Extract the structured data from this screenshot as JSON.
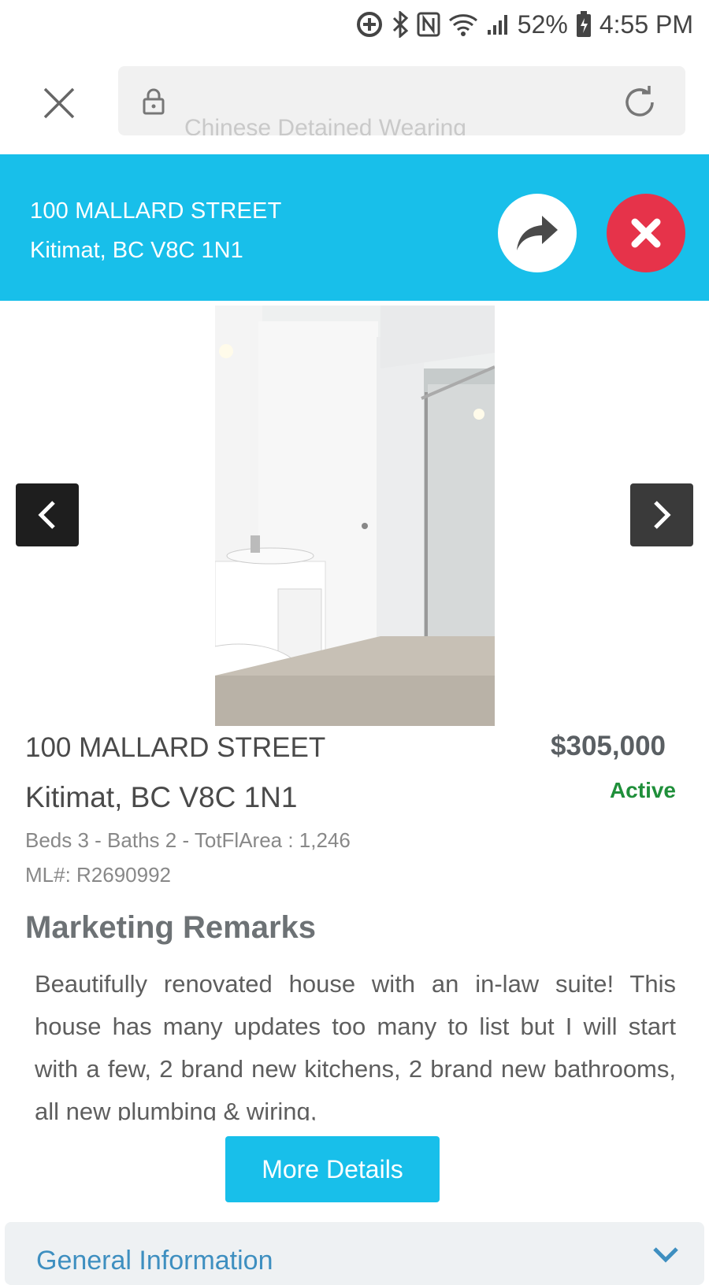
{
  "status_bar": {
    "battery": "52%",
    "time": "4:55 PM",
    "icons": [
      "data-saver-icon",
      "bluetooth-icon",
      "nfc-icon",
      "wifi-icon",
      "signal-icon",
      "battery-charging-icon"
    ]
  },
  "browser": {
    "url_text": "Chinese Detained Wearing",
    "icons": [
      "close-icon",
      "lock-icon",
      "reload-icon"
    ]
  },
  "header": {
    "street": "100 MALLARD STREET",
    "city": "Kitimat, BC V8C 1N1",
    "accent_color": "#18bfea",
    "dismiss_color": "#e6334a"
  },
  "listing": {
    "street": "100 MALLARD STREET",
    "city": "Kitimat, BC V8C 1N1",
    "price": "$305,000",
    "status": "Active",
    "status_color": "#1f8f3a",
    "specs": "Beds 3 - Baths 2 - TotFlArea : 1,246",
    "mls": "ML#: R2690992"
  },
  "remarks": {
    "title": "Marketing Remarks",
    "body": "Beautifully renovated house with an in-law suite! This house has many updates too many to list but I will start with a few, 2 brand new kitchens, 2 brand new bathrooms, all new plumbing & wiring,"
  },
  "more_button": {
    "label": "More Details"
  },
  "general_panel": {
    "title": "General Information"
  }
}
